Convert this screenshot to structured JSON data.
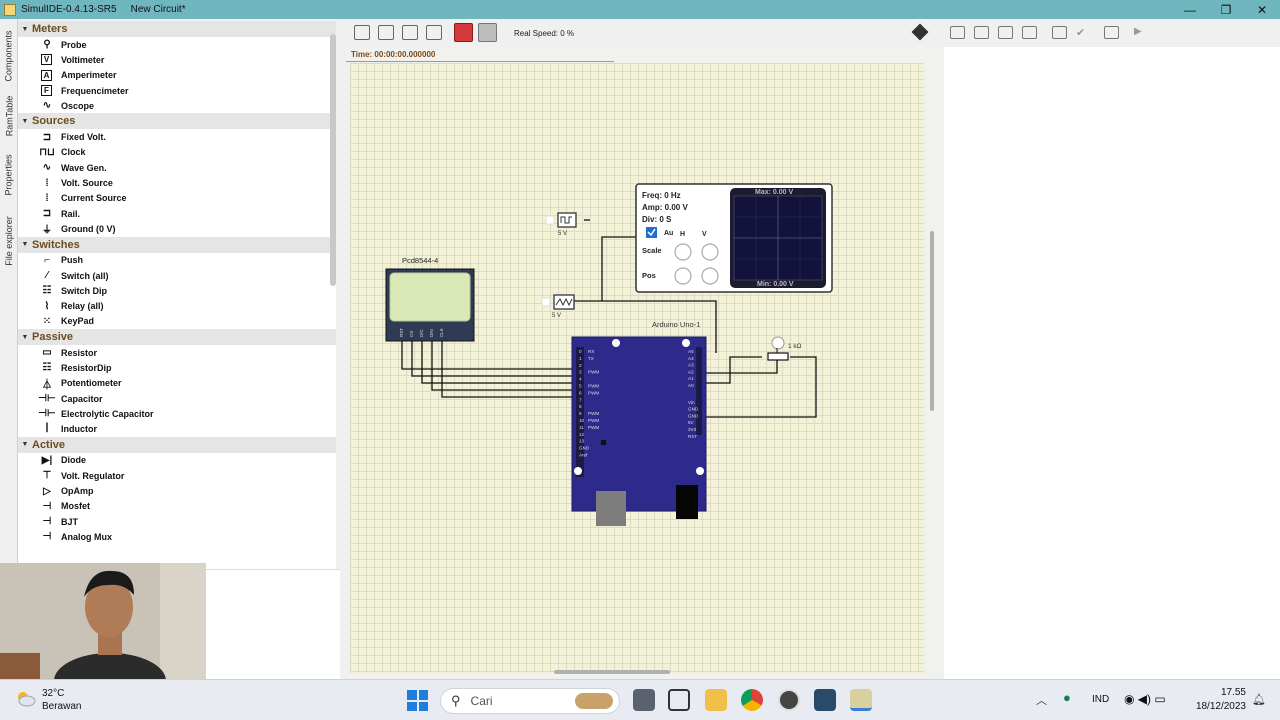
{
  "window": {
    "title": "SimulIDE-0.4.13-SR5",
    "document": "New Circuit*",
    "minimize": "—",
    "maximize": "❐",
    "close": "✕"
  },
  "side_tabs": [
    "Components",
    "RamTable",
    "Properties",
    "File explorer"
  ],
  "categories": [
    {
      "name": "Meters",
      "items": [
        {
          "label": "Probe",
          "icon": "probe-icon",
          "glyph": "⚲"
        },
        {
          "label": "Voltimeter",
          "icon": "voltmeter-icon",
          "glyph": "V"
        },
        {
          "label": "Amperimeter",
          "icon": "ammeter-icon",
          "glyph": "A"
        },
        {
          "label": "Frequencimeter",
          "icon": "frequency-meter-icon",
          "glyph": "F"
        },
        {
          "label": "Oscope",
          "icon": "oscilloscope-icon",
          "glyph": "∿"
        }
      ]
    },
    {
      "name": "Sources",
      "items": [
        {
          "label": "Fixed Volt.",
          "icon": "fixed-volt-icon",
          "glyph": "⊐"
        },
        {
          "label": "Clock",
          "icon": "clock-icon",
          "glyph": "⊓⊔"
        },
        {
          "label": "Wave Gen.",
          "icon": "wave-gen-icon",
          "glyph": "∿"
        },
        {
          "label": "Volt. Source",
          "icon": "volt-source-icon",
          "glyph": "⁞"
        },
        {
          "label": "Current Source",
          "icon": "current-source-icon",
          "glyph": "⁞"
        },
        {
          "label": "Rail.",
          "icon": "rail-icon",
          "glyph": "⊐"
        },
        {
          "label": "Ground (0 V)",
          "icon": "ground-icon",
          "glyph": "⏚"
        }
      ]
    },
    {
      "name": "Switches",
      "items": [
        {
          "label": "Push",
          "icon": "push-icon",
          "glyph": "⌐"
        },
        {
          "label": "Switch (all)",
          "icon": "switch-icon",
          "glyph": "⁄"
        },
        {
          "label": "Switch Dip",
          "icon": "switch-dip-icon",
          "glyph": "☷"
        },
        {
          "label": "Relay (all)",
          "icon": "relay-icon",
          "glyph": "⌇"
        },
        {
          "label": "KeyPad",
          "icon": "keypad-icon",
          "glyph": "⁙"
        }
      ]
    },
    {
      "name": "Passive",
      "items": [
        {
          "label": "Resistor",
          "icon": "resistor-icon",
          "glyph": "▭"
        },
        {
          "label": "ResistorDip",
          "icon": "resistor-dip-icon",
          "glyph": "☷"
        },
        {
          "label": "Potentiometer",
          "icon": "potentiometer-icon",
          "glyph": "⏃"
        },
        {
          "label": "Capacitor",
          "icon": "capacitor-icon",
          "glyph": "⊣⊢"
        },
        {
          "label": "Electrolytic Capacitor",
          "icon": "electrolytic-capacitor-icon",
          "glyph": "⊣⊢"
        },
        {
          "label": "Inductor",
          "icon": "inductor-icon",
          "glyph": "ꟾ"
        }
      ]
    },
    {
      "name": "Active",
      "items": [
        {
          "label": "Diode",
          "icon": "diode-icon",
          "glyph": "▶|"
        },
        {
          "label": "Volt. Regulator",
          "icon": "volt-regulator-icon",
          "glyph": "⊤"
        },
        {
          "label": "OpAmp",
          "icon": "opamp-icon",
          "glyph": "▷"
        },
        {
          "label": "Mosfet",
          "icon": "mosfet-icon",
          "glyph": "⊣"
        },
        {
          "label": "BJT",
          "icon": "bjt-icon",
          "glyph": "⊣"
        },
        {
          "label": "Analog Mux",
          "icon": "analog-mux-icon",
          "glyph": "⊣"
        }
      ]
    }
  ],
  "toolbar": {
    "real_speed": "Real Speed: 0 %"
  },
  "canvas": {
    "time": "Time: 00:00:00.000000",
    "lcd": {
      "label": "Pcd8544-4",
      "pins": [
        "RST",
        "CS",
        "D/C",
        "DIN",
        "CLK"
      ]
    },
    "clock_source": {
      "label": "5 V"
    },
    "wave_source": {
      "label": "5 V"
    },
    "arduino": {
      "label": "Arduino Uno-1",
      "left_pins": [
        "0",
        "1",
        "2",
        "3",
        "4",
        "5",
        "6",
        "7",
        "8",
        "9",
        "10",
        "11",
        "12",
        "13",
        "GND",
        "Aref"
      ],
      "left_pin_labels": [
        "RX",
        "TX",
        "",
        "PWM",
        "",
        "PWM",
        "PWM",
        "",
        "",
        "PWM",
        "PWM",
        "PWM",
        "",
        "",
        "",
        ""
      ],
      "right_pins": [
        "A5",
        "A4",
        "A3",
        "A2",
        "A1",
        "A0",
        "Vin",
        "GND",
        "GND",
        "5V",
        "3V3",
        "RST"
      ]
    },
    "potentiometer": {
      "label": "1 kΩ"
    },
    "oscilloscope": {
      "freq": "Freq: 0 Hz",
      "amp": "Amp: 0.00 V",
      "div": "Div: 0 S",
      "auto": "Au",
      "h": "H",
      "v": "V",
      "scale": "Scale",
      "pos": "Pos",
      "max": "Max: 0.00 V",
      "min": "Min: 0.00 V"
    }
  },
  "taskbar": {
    "temperature": "32°C",
    "weather": "Berawan",
    "search": "Cari",
    "language": "IND",
    "time": "17.55",
    "date": "18/12/2023"
  }
}
